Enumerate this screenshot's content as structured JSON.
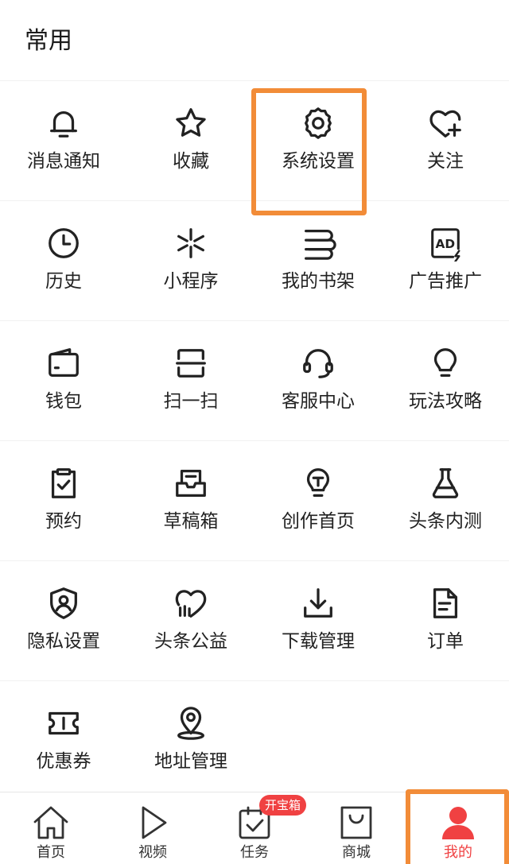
{
  "section": {
    "title": "常用"
  },
  "grid": [
    [
      {
        "label": "消息通知",
        "icon": "bell-icon"
      },
      {
        "label": "收藏",
        "icon": "star-icon"
      },
      {
        "label": "系统设置",
        "icon": "gear-icon"
      },
      {
        "label": "关注",
        "icon": "heart-plus-icon"
      }
    ],
    [
      {
        "label": "历史",
        "icon": "clock-icon"
      },
      {
        "label": "小程序",
        "icon": "mini-program-icon"
      },
      {
        "label": "我的书架",
        "icon": "bookshelf-icon"
      },
      {
        "label": "广告推广",
        "icon": "ad-icon"
      }
    ],
    [
      {
        "label": "钱包",
        "icon": "wallet-icon"
      },
      {
        "label": "扫一扫",
        "icon": "scan-icon"
      },
      {
        "label": "客服中心",
        "icon": "headset-icon"
      },
      {
        "label": "玩法攻略",
        "icon": "lightbulb-icon"
      }
    ],
    [
      {
        "label": "预约",
        "icon": "clipboard-check-icon"
      },
      {
        "label": "草稿箱",
        "icon": "drafts-tray-icon"
      },
      {
        "label": "创作首页",
        "icon": "creator-bulb-icon"
      },
      {
        "label": "头条内测",
        "icon": "flask-icon"
      }
    ],
    [
      {
        "label": "隐私设置",
        "icon": "shield-user-icon"
      },
      {
        "label": "头条公益",
        "icon": "charity-heart-icon"
      },
      {
        "label": "下载管理",
        "icon": "download-icon"
      },
      {
        "label": "订单",
        "icon": "document-icon"
      }
    ],
    [
      {
        "label": "优惠券",
        "icon": "coupon-icon"
      },
      {
        "label": "地址管理",
        "icon": "location-pin-icon"
      }
    ]
  ],
  "tabbar": {
    "items": [
      {
        "label": "首页",
        "icon": "home-icon"
      },
      {
        "label": "视频",
        "icon": "play-icon"
      },
      {
        "label": "任务",
        "icon": "task-icon"
      },
      {
        "label": "商城",
        "icon": "shopping-bag-icon"
      },
      {
        "label": "我的",
        "icon": "user-icon",
        "active": true
      }
    ],
    "badge": "开宝箱"
  },
  "colors": {
    "accent": "#f04142",
    "highlight": "#f28c38",
    "icon_stroke": "#222222"
  }
}
